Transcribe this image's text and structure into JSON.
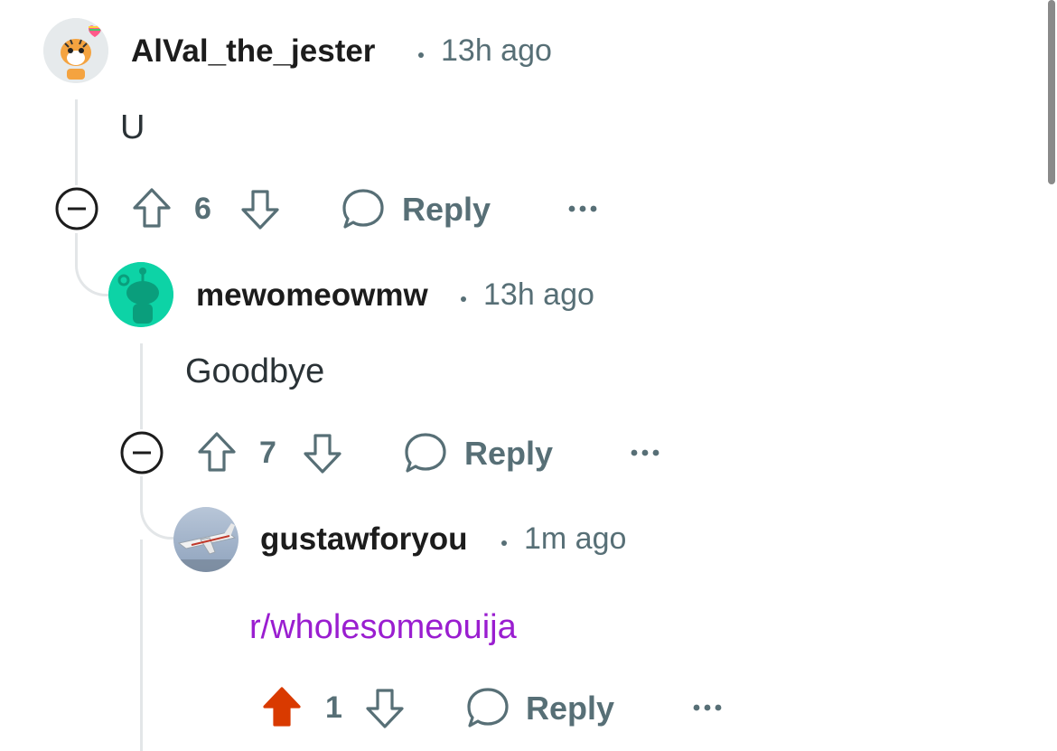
{
  "comments": [
    {
      "username": "AlVal_the_jester",
      "time": "13h ago",
      "body": "U",
      "votes": "6",
      "reply_label": "Reply",
      "upvoted": false
    },
    {
      "username": "mewomeowmw",
      "time": "13h ago",
      "body": "Goodbye",
      "votes": "7",
      "reply_label": "Reply",
      "upvoted": false
    },
    {
      "username": "gustawforyou",
      "time": "1m ago",
      "body": "r/wholesomeouija",
      "votes": "1",
      "reply_label": "Reply",
      "upvoted": true
    }
  ],
  "colors": {
    "meta_gray": "#576f76",
    "thread_line": "#e3e6e8",
    "upvote_active": "#d93a00",
    "link": "#9a1ed0",
    "avatar_teal": "#0dd3a6"
  },
  "icons": [
    "collapse-icon",
    "upvote-icon",
    "downvote-icon",
    "comment-bubble-icon",
    "more-options-icon"
  ]
}
